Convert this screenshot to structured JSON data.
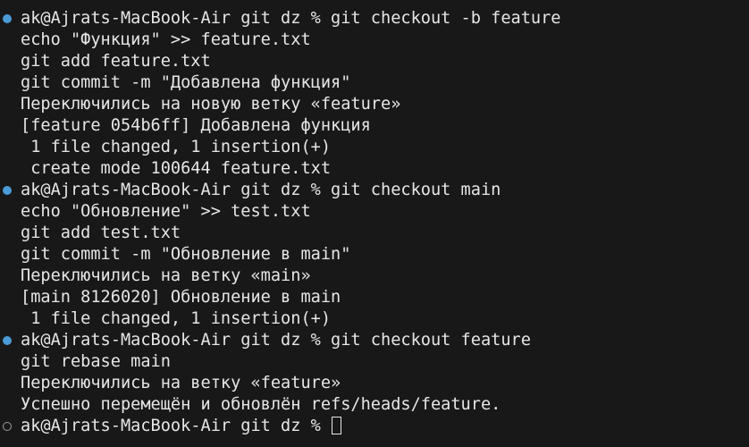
{
  "colors": {
    "background": "#181818",
    "text": "#e6e6e6",
    "success_marker": "#4b9bd6",
    "pending_marker": "#9a9a9a"
  },
  "terminal": {
    "lines": [
      {
        "marker": "filled",
        "text": "ak@Ajrats-MacBook-Air git dz % git checkout -b feature"
      },
      {
        "marker": null,
        "text": "echo \"Функция\" >> feature.txt"
      },
      {
        "marker": null,
        "text": "git add feature.txt"
      },
      {
        "marker": null,
        "text": "git commit -m \"Добавлена функция\""
      },
      {
        "marker": null,
        "text": "Переключились на новую ветку «feature»"
      },
      {
        "marker": null,
        "text": "[feature 054b6ff] Добавлена функция"
      },
      {
        "marker": null,
        "text": " 1 file changed, 1 insertion(+)"
      },
      {
        "marker": null,
        "text": " create mode 100644 feature.txt"
      },
      {
        "marker": "filled",
        "text": "ak@Ajrats-MacBook-Air git dz % git checkout main"
      },
      {
        "marker": null,
        "text": "echo \"Обновление\" >> test.txt"
      },
      {
        "marker": null,
        "text": "git add test.txt"
      },
      {
        "marker": null,
        "text": "git commit -m \"Обновление в main\""
      },
      {
        "marker": null,
        "text": "Переключились на ветку «main»"
      },
      {
        "marker": null,
        "text": "[main 8126020] Обновление в main"
      },
      {
        "marker": null,
        "text": " 1 file changed, 1 insertion(+)"
      },
      {
        "marker": "filled",
        "text": "ak@Ajrats-MacBook-Air git dz % git checkout feature"
      },
      {
        "marker": null,
        "text": "git rebase main"
      },
      {
        "marker": null,
        "text": "Переключились на ветку «feature»"
      },
      {
        "marker": null,
        "text": "Успешно перемещён и обновлён refs/heads/feature."
      },
      {
        "marker": "hollow",
        "text": "ak@Ajrats-MacBook-Air git dz % ",
        "cursor": true
      }
    ]
  }
}
